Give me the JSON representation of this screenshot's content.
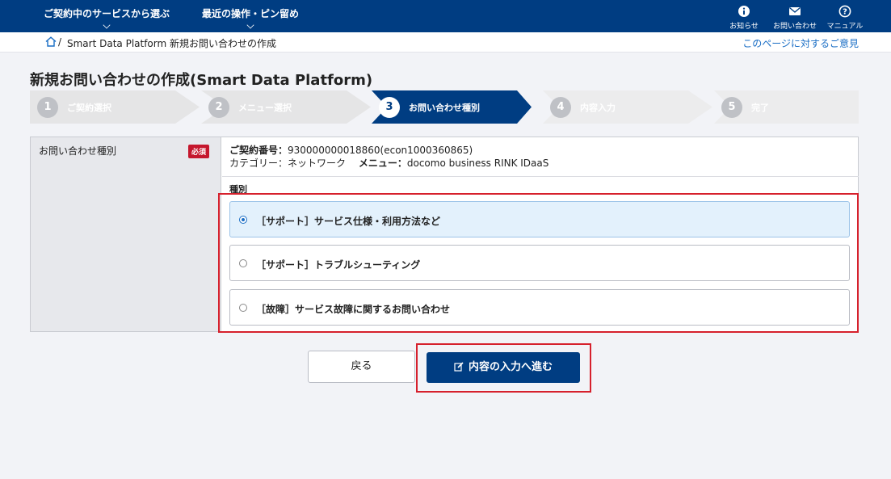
{
  "header": {
    "menus": [
      {
        "label": "ご契約中のサービスから選ぶ"
      },
      {
        "label": "最近の操作・ピン留め"
      }
    ],
    "links": [
      {
        "label": "お知らせ",
        "icon": "info-icon"
      },
      {
        "label": "お問い合わせ",
        "icon": "mail-icon"
      },
      {
        "label": "マニュアル",
        "icon": "help-icon"
      }
    ]
  },
  "breadcrumb": {
    "separator": "/",
    "current": "Smart Data Platform 新規お問い合わせの作成",
    "feedback": "このページに対するご意見"
  },
  "page": {
    "title": "新規お問い合わせの作成(Smart Data Platform)"
  },
  "steps": [
    {
      "num": "1",
      "label": "ご契約選択",
      "state": "done"
    },
    {
      "num": "2",
      "label": "メニュー選択",
      "state": "done"
    },
    {
      "num": "3",
      "label": "お問い合わせ種別",
      "state": "active"
    },
    {
      "num": "4",
      "label": "内容入力",
      "state": "pending"
    },
    {
      "num": "5",
      "label": "完了",
      "state": "pending"
    }
  ],
  "form": {
    "field_label": "お問い合わせ種別",
    "required_badge": "必須",
    "contract_label": "ご契約番号：",
    "contract_value": "930000000018860(econ1000360865)",
    "category_label": "カテゴリー：",
    "category_value": "ネットワーク",
    "menu_label": "メニュー：",
    "menu_value": "docomo business RINK IDaaS",
    "type_label": "種別",
    "options": [
      {
        "label": "［サポート］サービス仕様・利用方法など",
        "selected": true
      },
      {
        "label": "［サポート］トラブルシューティング",
        "selected": false
      },
      {
        "label": "［故障］サービス故障に関するお問い合わせ",
        "selected": false
      }
    ]
  },
  "actions": {
    "back": "戻る",
    "next": "内容の入力へ進む"
  },
  "colors": {
    "brand": "#003d82",
    "highlight": "#d6202c",
    "required": "#c5172d",
    "link": "#1a6ec5",
    "step_done": "#e5e5e6",
    "step_pending": "#ececed"
  }
}
